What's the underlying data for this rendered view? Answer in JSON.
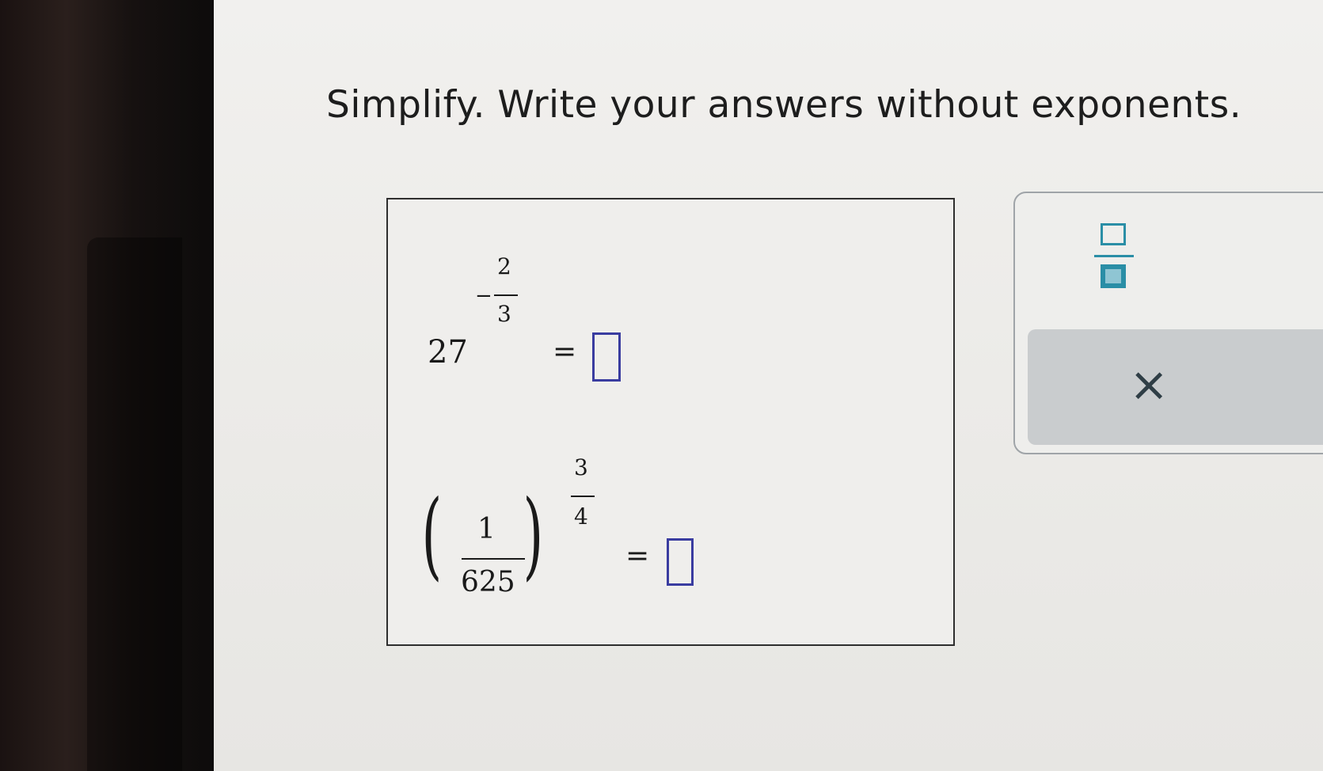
{
  "instruction": "Simplify. Write your answers without exponents.",
  "problems": [
    {
      "base": "27",
      "exponent_sign": "−",
      "exponent_numerator": "2",
      "exponent_denominator": "3",
      "equals": "=",
      "answer": ""
    },
    {
      "fraction_numerator": "1",
      "fraction_denominator": "625",
      "left_paren": "(",
      "right_paren": ")",
      "exponent_numerator": "3",
      "exponent_denominator": "4",
      "equals": "=",
      "answer": ""
    }
  ],
  "tools": {
    "fraction_icon": "fraction-template-icon",
    "clear_icon": "×"
  },
  "colors": {
    "answer_box_border": "#3a3ca0",
    "tool_accent": "#2a8ea6"
  }
}
